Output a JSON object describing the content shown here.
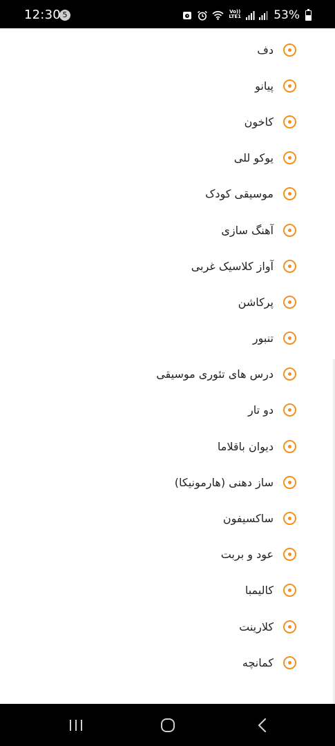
{
  "status_bar": {
    "time": "12:30",
    "notification_count": "5",
    "volte_top": "Vo))",
    "volte_bottom": "LTE1",
    "battery": "53%",
    "battery_level": 0.53
  },
  "list": {
    "items": [
      {
        "label": "دف"
      },
      {
        "label": "پیانو"
      },
      {
        "label": "کاخون"
      },
      {
        "label": "یوکو للی"
      },
      {
        "label": "موسیقی کودک"
      },
      {
        "label": "آهنگ سازی"
      },
      {
        "label": "آواز کلاسیک غربی"
      },
      {
        "label": "پرکاشن"
      },
      {
        "label": "تنبور"
      },
      {
        "label": "درس های تئوری موسیقی"
      },
      {
        "label": "دو تار"
      },
      {
        "label": "دیوان باقلاما"
      },
      {
        "label": "ساز دهنی (هارمونیکا)"
      },
      {
        "label": "ساکسیفون"
      },
      {
        "label": "عود و بربت"
      },
      {
        "label": "کالیمبا"
      },
      {
        "label": "کلارینت"
      },
      {
        "label": "کمانچه"
      }
    ]
  },
  "colors": {
    "accent": "#f4901f",
    "text": "#222222",
    "bars": "#000000"
  },
  "nav_bar": {
    "icons": [
      "recent-apps-icon",
      "home-icon",
      "back-icon"
    ]
  }
}
